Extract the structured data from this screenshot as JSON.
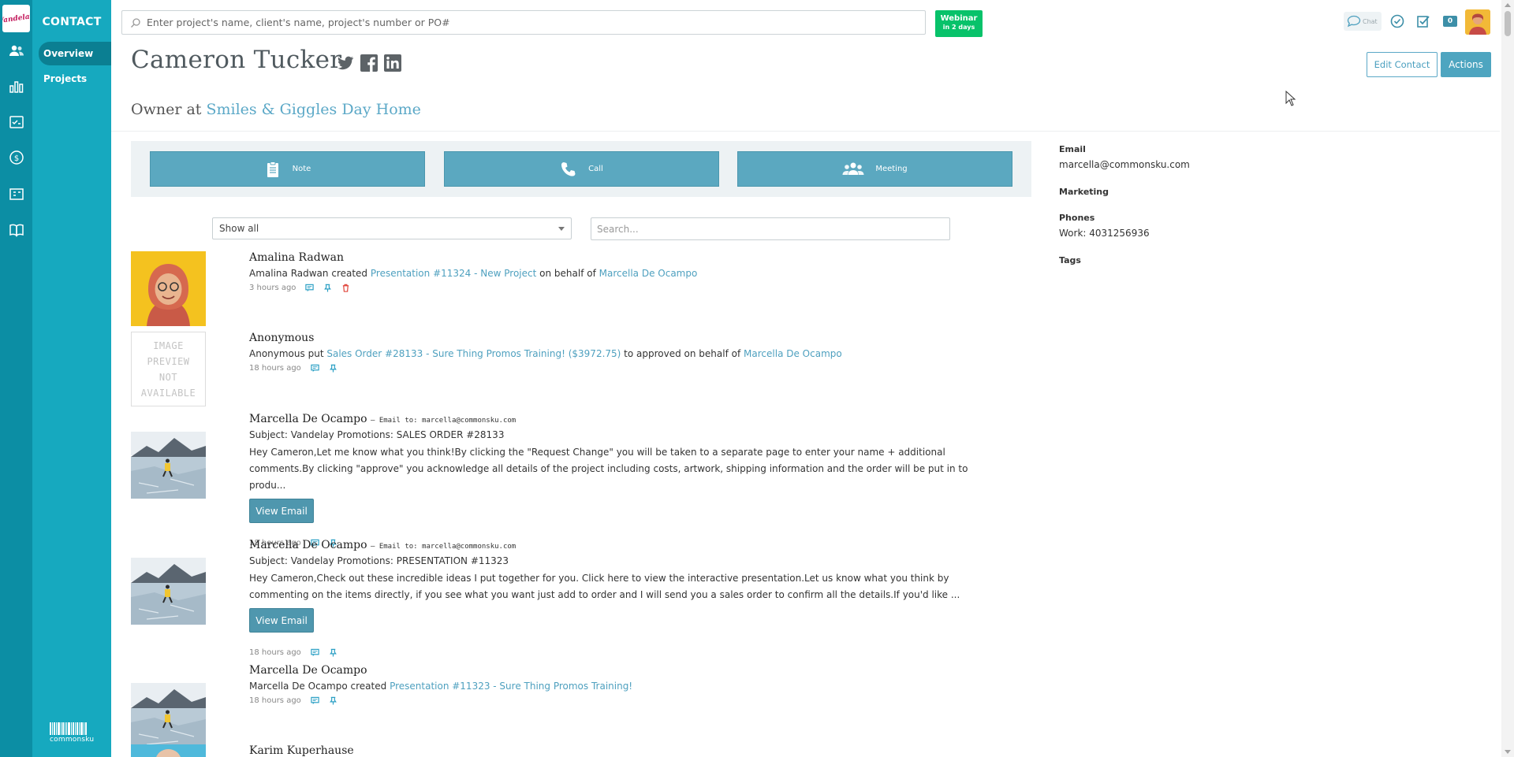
{
  "nav": {
    "logo_text": "Vandelay",
    "section_title": "CONTACT",
    "items": [
      {
        "label": "Overview"
      },
      {
        "label": "Projects"
      }
    ],
    "footer_brand": "commonsku"
  },
  "topbar": {
    "search_placeholder": "Enter project's name, client's name, project's number or PO#",
    "webinar_title": "Webinar",
    "webinar_sub": "in 2 days",
    "chat_label": "Chat",
    "notification_count": "0"
  },
  "contact": {
    "name": "Cameron Tucker",
    "role_prefix": "Owner at",
    "company": "Smiles & Giggles Day Home",
    "edit_label": "Edit Contact",
    "actions_label": "Actions"
  },
  "activity_buttons": {
    "note": "Note",
    "call": "Call",
    "meeting": "Meeting"
  },
  "filter": {
    "selected": "Show all",
    "search_placeholder": "Search..."
  },
  "feed": [
    {
      "author": "Amalina Radwan",
      "actor": "Amalina Radwan",
      "verb": "created",
      "link": "Presentation #11324 - New Project",
      "mid": "on behalf of",
      "link2": "Marcella De Ocampo",
      "time": "3 hours ago"
    },
    {
      "author": "Anonymous",
      "thumb_text_1": "IMAGE PREVIEW",
      "thumb_text_2": "NOT AVAILABLE",
      "actor": "Anonymous",
      "verb": "put",
      "link": "Sales Order #28133 - Sure Thing Promos Training! ($3972.75)",
      "mid": "to approved on behalf of",
      "link2": "Marcella De Ocampo",
      "time": "18 hours ago"
    },
    {
      "author": "Marcella De Ocampo",
      "emailto": "– Email to: marcella@commonsku.com",
      "subject": "Subject: Vandelay Promotions: SALES ORDER #28133",
      "text": "Hey Cameron,Let me know what you think!By clicking the \"Request Change\" you will be taken to a separate page to enter your name + additional comments.By clicking \"approve\" you acknowledge all details of the project including costs, artwork, shipping information and the order will be put in to produ...",
      "button": "View Email",
      "time": "18 hours ago"
    },
    {
      "author": "Marcella De Ocampo",
      "emailto": "– Email to: marcella@commonsku.com",
      "subject": "Subject: Vandelay Promotions: PRESENTATION #11323",
      "text": "Hey Cameron,Check out these incredible ideas I put together for you. Click here to view the interactive presentation.Let us know what you think by commenting on the items directly, if you see what you want just add to order and I will send you a sales order to confirm all the details.If you'd like ...",
      "button": "View Email",
      "time": "18 hours ago"
    },
    {
      "author": "Marcella De Ocampo",
      "actor": "Marcella De Ocampo",
      "verb": "created",
      "link": "Presentation #11323 - Sure Thing Promos Training!",
      "time": "18 hours ago"
    },
    {
      "author": "Karim Kuperhause"
    }
  ],
  "info": {
    "email_label": "Email",
    "email_value": "marcella@commonsku.com",
    "department": "Marketing",
    "phones_label": "Phones",
    "phone_value": "Work: 4031256936",
    "tags_label": "Tags"
  },
  "colors": {
    "rail": "#0c8ea4",
    "subnav": "#16a9bf",
    "accent": "#5ba8c0",
    "webinar": "#08c26a",
    "link": "#4ea0bf"
  }
}
